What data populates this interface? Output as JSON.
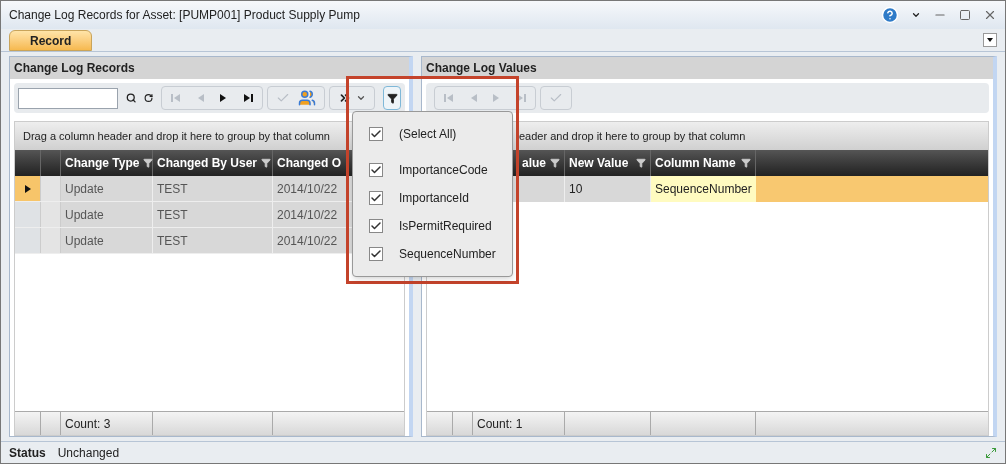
{
  "window": {
    "title": "Change Log Records for Asset: [PUMP001] Product Supply Pump"
  },
  "tabs": [
    {
      "label": "Record",
      "selected": true
    }
  ],
  "left_panel": {
    "title": "Change Log Records",
    "group_hint": "Drag a column header and drop it here to group by that column",
    "columns": [
      {
        "label": "Change Type",
        "filter": true
      },
      {
        "label": "Changed By User",
        "filter": true
      },
      {
        "label": "Changed O"
      }
    ],
    "rows": [
      {
        "selected": true,
        "cells": [
          "Update",
          "TEST",
          "2014/10/22"
        ]
      },
      {
        "selected": false,
        "cells": [
          "Update",
          "TEST",
          "2014/10/22"
        ]
      },
      {
        "selected": false,
        "cells": [
          "Update",
          "TEST",
          "2014/10/22"
        ]
      }
    ],
    "count": "Count: 3"
  },
  "right_panel": {
    "title": "Change Log Values",
    "group_hint": "eader and drop it here to group by that column",
    "columns": [
      {
        "label": "alue",
        "filter": true
      },
      {
        "label": "New Value",
        "filter": true
      },
      {
        "label": "Column Name",
        "filter": true
      }
    ],
    "rows": [
      {
        "selected": true,
        "new_value": "10",
        "column_name": "SequenceNumber"
      }
    ],
    "count": "Count: 1"
  },
  "filter_menu": {
    "items": [
      {
        "label": "(Select All)",
        "checked": true
      },
      {
        "label": "ImportanceCode",
        "checked": true
      },
      {
        "label": "ImportanceId",
        "checked": true
      },
      {
        "label": "IsPermitRequired",
        "checked": true
      },
      {
        "label": "SequenceNumber",
        "checked": true
      }
    ]
  },
  "status_bar": {
    "label": "Status",
    "value": "Unchanged"
  }
}
